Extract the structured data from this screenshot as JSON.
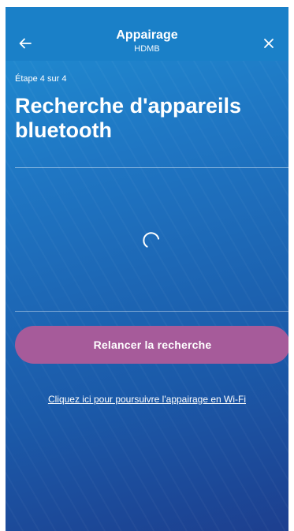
{
  "header": {
    "title": "Appairage",
    "subtitle": "HDMB",
    "back_icon": "arrow-left-icon",
    "close_icon": "close-icon"
  },
  "step": {
    "label": "Étape 4 sur 4"
  },
  "main": {
    "title": "Recherche d'appareils bluetooth",
    "loading_icon": "spinner-icon"
  },
  "actions": {
    "retry_label": "Relancer la recherche",
    "wifi_link": "Cliquez ici pour poursuivre l'appairage en Wi-Fi"
  },
  "colors": {
    "header_bg": "#1a80c8",
    "accent_button": "#a65b9a",
    "gradient_top": "#1f8fd3",
    "gradient_bottom": "#1d3f8f"
  }
}
